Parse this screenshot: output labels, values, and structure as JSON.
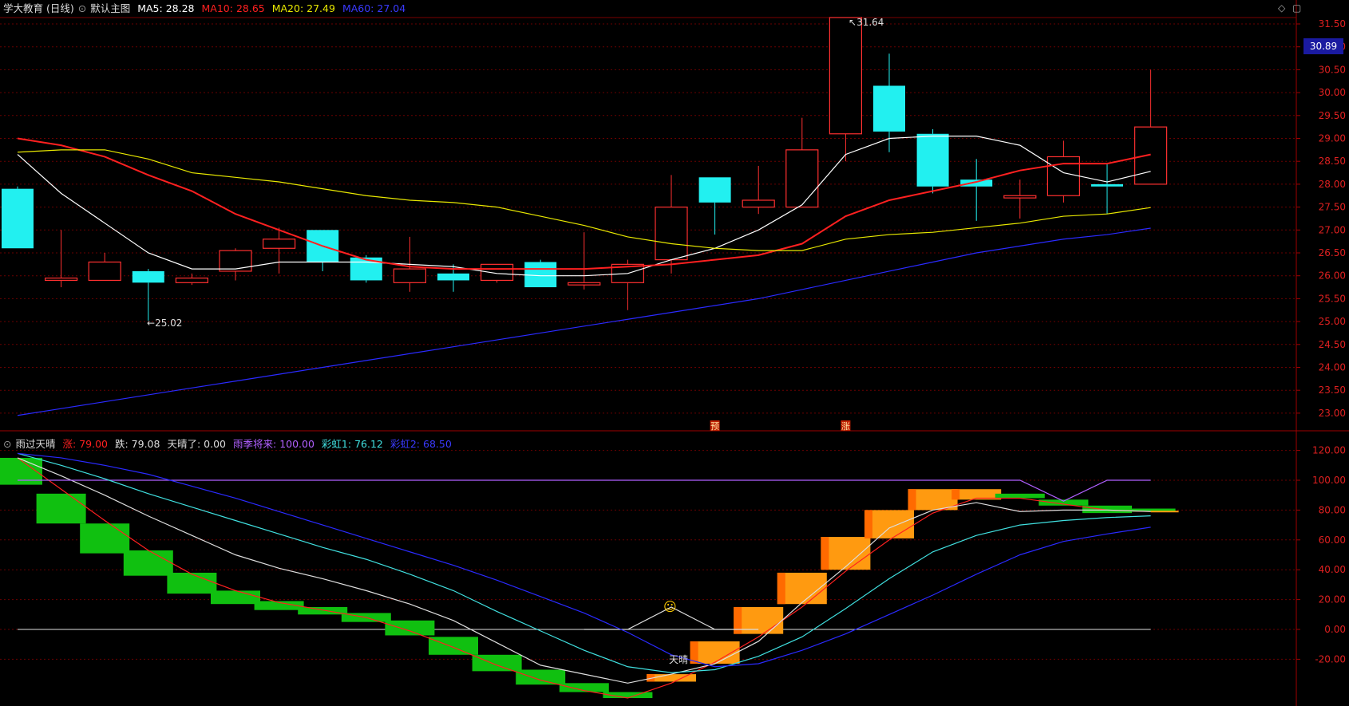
{
  "main_panel": {
    "title": "学大教育 (日线)",
    "mode_label": "默认主图",
    "ma5": {
      "label": "MA5:",
      "value": "28.28",
      "color": "#ffffff"
    },
    "ma10": {
      "label": "MA10:",
      "value": "28.65",
      "color": "#ff2020"
    },
    "ma20": {
      "label": "MA20:",
      "value": "27.49",
      "color": "#e8e800"
    },
    "ma60": {
      "label": "MA60:",
      "value": "27.04",
      "color": "#2a2aff"
    },
    "current_price": "30.89",
    "high_annotation": "31.64",
    "low_annotation": "25.02",
    "markers": [
      {
        "day": 16,
        "text": "预"
      },
      {
        "day": 19,
        "text": "涨"
      }
    ]
  },
  "sub_panel": {
    "title": "雨过天晴",
    "zhang": {
      "label": "涨:",
      "value": "79.00",
      "color": "#ff2020"
    },
    "die": {
      "label": "跌:",
      "value": "79.08",
      "color": "#dddddd"
    },
    "tianqing": {
      "label": "天晴了:",
      "value": "0.00",
      "color": "#dddddd"
    },
    "yuji": {
      "label": "雨季将来:",
      "value": "100.00",
      "color": "#b060ff"
    },
    "caihong1": {
      "label": "彩虹1:",
      "value": "76.12",
      "color": "#40e0e0"
    },
    "caihong2": {
      "label": "彩虹2:",
      "value": "68.50",
      "color": "#2a2aff"
    },
    "tianqing_text": "天晴",
    "smiley": "☺"
  },
  "chart_data": [
    {
      "type": "candlestick",
      "title": "学大教育 (日线)",
      "ylim": [
        22.7,
        31.9
      ],
      "yticks": [
        "23.00",
        "23.50",
        "24.00",
        "24.50",
        "25.00",
        "25.50",
        "26.00",
        "26.50",
        "27.00",
        "27.50",
        "28.00",
        "28.50",
        "29.00",
        "29.50",
        "30.00",
        "30.50",
        "31.00",
        "31.50"
      ],
      "candles": [
        {
          "o": 27.9,
          "c": 26.6,
          "h": 27.95,
          "l": 26.6
        },
        {
          "o": 25.9,
          "c": 25.95,
          "h": 27.0,
          "l": 25.75
        },
        {
          "o": 25.9,
          "c": 26.3,
          "h": 26.5,
          "l": 25.9
        },
        {
          "o": 26.1,
          "c": 25.85,
          "h": 26.15,
          "l": 25.02
        },
        {
          "o": 25.85,
          "c": 25.95,
          "h": 26.05,
          "l": 25.8
        },
        {
          "o": 26.1,
          "c": 26.55,
          "h": 26.6,
          "l": 25.9
        },
        {
          "o": 26.6,
          "c": 26.8,
          "h": 27.05,
          "l": 26.05
        },
        {
          "o": 27.0,
          "c": 26.3,
          "h": 27.0,
          "l": 26.1
        },
        {
          "o": 26.4,
          "c": 25.9,
          "h": 26.45,
          "l": 25.85
        },
        {
          "o": 25.85,
          "c": 26.15,
          "h": 26.85,
          "l": 25.65
        },
        {
          "o": 26.05,
          "c": 25.9,
          "h": 26.25,
          "l": 25.65
        },
        {
          "o": 25.9,
          "c": 26.25,
          "h": 26.25,
          "l": 25.85
        },
        {
          "o": 26.3,
          "c": 25.75,
          "h": 26.35,
          "l": 25.75
        },
        {
          "o": 25.8,
          "c": 25.85,
          "h": 26.95,
          "l": 25.7
        },
        {
          "o": 25.85,
          "c": 26.25,
          "h": 26.35,
          "l": 25.25
        },
        {
          "o": 26.35,
          "c": 27.5,
          "h": 28.2,
          "l": 26.05
        },
        {
          "o": 28.15,
          "c": 27.6,
          "h": 28.15,
          "l": 26.9
        },
        {
          "o": 27.5,
          "c": 27.65,
          "h": 28.4,
          "l": 27.35
        },
        {
          "o": 27.5,
          "c": 28.75,
          "h": 29.45,
          "l": 27.5
        },
        {
          "o": 29.1,
          "c": 31.64,
          "h": 31.64,
          "l": 28.5
        },
        {
          "o": 30.15,
          "c": 29.15,
          "h": 30.85,
          "l": 28.7
        },
        {
          "o": 29.1,
          "c": 27.95,
          "h": 29.2,
          "l": 27.8
        },
        {
          "o": 28.1,
          "c": 27.95,
          "h": 28.55,
          "l": 27.2
        },
        {
          "o": 27.7,
          "c": 27.75,
          "h": 28.1,
          "l": 27.25
        },
        {
          "o": 27.75,
          "c": 28.6,
          "h": 28.95,
          "l": 27.6
        },
        {
          "o": 28.0,
          "c": 27.95,
          "h": 28.45,
          "l": 27.35
        },
        {
          "o": 28.0,
          "c": 29.25,
          "h": 30.5,
          "l": 28.0
        }
      ],
      "series": [
        {
          "name": "MA5",
          "color": "#ffffff",
          "values": [
            28.65,
            27.8,
            27.15,
            26.5,
            26.15,
            26.15,
            26.3,
            26.3,
            26.3,
            26.25,
            26.2,
            26.05,
            26.0,
            26.0,
            26.05,
            26.35,
            26.6,
            27.0,
            27.55,
            28.65,
            29.0,
            29.05,
            29.05,
            28.85,
            28.25,
            28.05,
            28.28
          ]
        },
        {
          "name": "MA10",
          "color": "#ff2020",
          "values": [
            29.0,
            28.85,
            28.6,
            28.2,
            27.85,
            27.35,
            27.0,
            26.65,
            26.35,
            26.2,
            26.15,
            26.15,
            26.15,
            26.15,
            26.2,
            26.25,
            26.35,
            26.45,
            26.7,
            27.3,
            27.65,
            27.85,
            28.05,
            28.3,
            28.45,
            28.45,
            28.65
          ]
        },
        {
          "name": "MA20",
          "color": "#e8e800",
          "values": [
            28.7,
            28.75,
            28.75,
            28.55,
            28.25,
            28.15,
            28.05,
            27.9,
            27.75,
            27.65,
            27.6,
            27.5,
            27.3,
            27.1,
            26.85,
            26.7,
            26.6,
            26.55,
            26.55,
            26.8,
            26.9,
            26.95,
            27.05,
            27.15,
            27.3,
            27.35,
            27.49
          ]
        },
        {
          "name": "MA60",
          "color": "#2a2aff",
          "values": [
            22.95,
            23.1,
            23.25,
            23.4,
            23.55,
            23.7,
            23.85,
            24.0,
            24.15,
            24.3,
            24.45,
            24.6,
            24.75,
            24.9,
            25.05,
            25.2,
            25.35,
            25.5,
            25.7,
            25.9,
            26.1,
            26.3,
            26.5,
            26.65,
            26.8,
            26.9,
            27.04
          ]
        }
      ]
    },
    {
      "type": "indicator",
      "title": "雨过天晴",
      "ylim": [
        -45,
        127
      ],
      "yticks": [
        "-20.00",
        "0.00",
        "20.00",
        "40.00",
        "60.00",
        "80.00",
        "100.00",
        "120.00"
      ],
      "bars": [
        {
          "from": 115,
          "to": 97,
          "dir": "down"
        },
        {
          "from": 91,
          "to": 71,
          "dir": "down"
        },
        {
          "from": 71,
          "to": 51,
          "dir": "down"
        },
        {
          "from": 53,
          "to": 36,
          "dir": "down"
        },
        {
          "from": 38,
          "to": 24,
          "dir": "down"
        },
        {
          "from": 26,
          "to": 17,
          "dir": "down"
        },
        {
          "from": 19,
          "to": 13,
          "dir": "down"
        },
        {
          "from": 15,
          "to": 10,
          "dir": "down"
        },
        {
          "from": 11,
          "to": 5,
          "dir": "down"
        },
        {
          "from": 6,
          "to": -4,
          "dir": "down"
        },
        {
          "from": -5,
          "to": -17,
          "dir": "down"
        },
        {
          "from": -17,
          "to": -28,
          "dir": "down"
        },
        {
          "from": -27,
          "to": -37,
          "dir": "down"
        },
        {
          "from": -36,
          "to": -42,
          "dir": "down"
        },
        {
          "from": -42,
          "to": -46,
          "dir": "down"
        },
        {
          "from": -30,
          "to": -35,
          "dir": "up"
        },
        {
          "from": -23,
          "to": -8,
          "dir": "up"
        },
        {
          "from": -3,
          "to": 15,
          "dir": "up"
        },
        {
          "from": 17,
          "to": 38,
          "dir": "up"
        },
        {
          "from": 40,
          "to": 62,
          "dir": "up"
        },
        {
          "from": 61,
          "to": 80,
          "dir": "up"
        },
        {
          "from": 80,
          "to": 94,
          "dir": "up"
        },
        {
          "from": 87,
          "to": 94,
          "dir": "up"
        },
        {
          "from": 88,
          "to": 91,
          "dir": "down"
        },
        {
          "from": 83,
          "to": 87,
          "dir": "down"
        },
        {
          "from": 78,
          "to": 83,
          "dir": "down"
        },
        {
          "from": 79,
          "to": 81,
          "dir": "down"
        }
      ],
      "series": [
        {
          "name": "涨",
          "color": "#ff2020",
          "values": [
            115,
            94,
            73,
            53,
            37,
            26,
            18,
            13,
            8,
            -1,
            -12,
            -24,
            -34,
            -41,
            -46,
            -36,
            -22,
            -5,
            15,
            39,
            60,
            78,
            88,
            88,
            84,
            80,
            79
          ]
        },
        {
          "name": "跌",
          "color": "#dddddd",
          "values": [
            115,
            103,
            90,
            76,
            63,
            50,
            41,
            34,
            26,
            17,
            6,
            -9,
            -24,
            -30,
            -36,
            -30,
            -23,
            -8,
            18,
            42,
            68,
            80,
            85,
            79,
            80,
            80,
            79.08
          ]
        },
        {
          "name": "天晴了",
          "color": "#dddddd",
          "values": [
            0,
            0,
            0,
            0,
            0,
            0,
            0,
            0,
            0,
            0,
            0,
            0,
            0,
            0,
            0,
            15,
            0,
            0,
            0,
            0,
            0,
            0,
            0,
            0,
            0,
            0,
            0
          ]
        },
        {
          "name": "雨季将来",
          "color": "#b060ff",
          "values": [
            100,
            100,
            100,
            100,
            100,
            100,
            100,
            100,
            100,
            100,
            100,
            100,
            100,
            100,
            100,
            100,
            100,
            100,
            100,
            100,
            100,
            100,
            100,
            100,
            86,
            100,
            100
          ]
        },
        {
          "name": "彩虹1",
          "color": "#40e0e0",
          "values": [
            118,
            110,
            101,
            91,
            82,
            73,
            64,
            55,
            47,
            37,
            26,
            12,
            -1,
            -14,
            -25,
            -29,
            -27,
            -18,
            -5,
            14,
            34,
            52,
            63,
            70,
            73,
            75,
            76.12
          ]
        },
        {
          "name": "彩虹2",
          "color": "#2a2aff",
          "values": [
            118,
            115,
            110,
            104,
            96,
            88,
            79,
            70,
            61,
            52,
            43,
            33,
            22,
            11,
            -2,
            -17,
            -25,
            -23,
            -14,
            -3,
            10,
            23,
            37,
            50,
            59,
            64,
            68.5
          ]
        }
      ]
    }
  ]
}
